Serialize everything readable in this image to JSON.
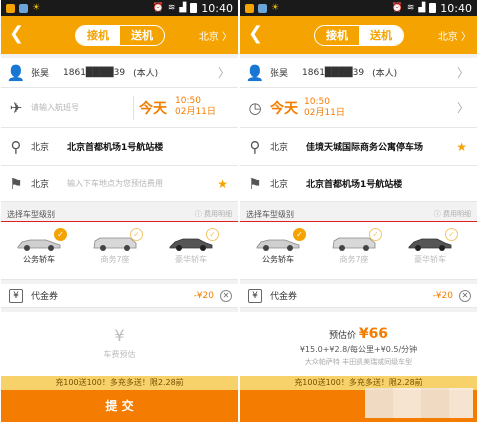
{
  "status_bar": {
    "time": "10:40"
  },
  "header": {
    "tabs": [
      "接机",
      "送机"
    ],
    "city": "北京 〉"
  },
  "passenger": {
    "name": "张昊",
    "phone": "1861████39",
    "self_tag": "(本人)"
  },
  "screen_a": {
    "active_tab": "接机",
    "flight_placeholder": "请输入航班号",
    "day": "今天",
    "time": "10:50",
    "date": "02月11日",
    "from_city": "北京",
    "from_address": "北京首都机场1号航站楼",
    "to_city": "北京",
    "to_placeholder": "输入下车地点为您预估费用",
    "section_title": "选择车型级别",
    "fee_link": "费用明细",
    "cars": [
      {
        "label": "公务轿车",
        "selected": true
      },
      {
        "label": "商务7座",
        "selected": false
      },
      {
        "label": "豪华轿车",
        "selected": false
      }
    ],
    "coupon_label": "代金券",
    "coupon_amount": "-¥20",
    "fare_icon": "¥",
    "fare_placeholder": "车费预估",
    "promo": "充100送100！多充多送！限2.28前",
    "submit": "提 交"
  },
  "screen_b": {
    "active_tab": "送机",
    "day": "今天",
    "time": "10:50",
    "date": "02月11日",
    "from_city": "北京",
    "from_address": "佳境天城国际商务公寓停车场",
    "to_city": "北京",
    "to_address": "北京首都机场1号航站楼",
    "section_title": "选择车型级别",
    "fee_link": "费用明细",
    "cars": [
      {
        "label": "公务轿车",
        "selected": true
      },
      {
        "label": "商务7座",
        "selected": false
      },
      {
        "label": "豪华轿车",
        "selected": false
      }
    ],
    "coupon_label": "代金券",
    "coupon_amount": "-¥20",
    "estimate_label": "预估价",
    "estimate_value": "¥66",
    "fare_rule": "¥15.0+¥2.8/每公里+¥0.5/分钟",
    "fare_note": "大众帕萨特 丰田凯美瑞或同级车型",
    "promo": "充100送100！多充多送！限2.28前"
  }
}
